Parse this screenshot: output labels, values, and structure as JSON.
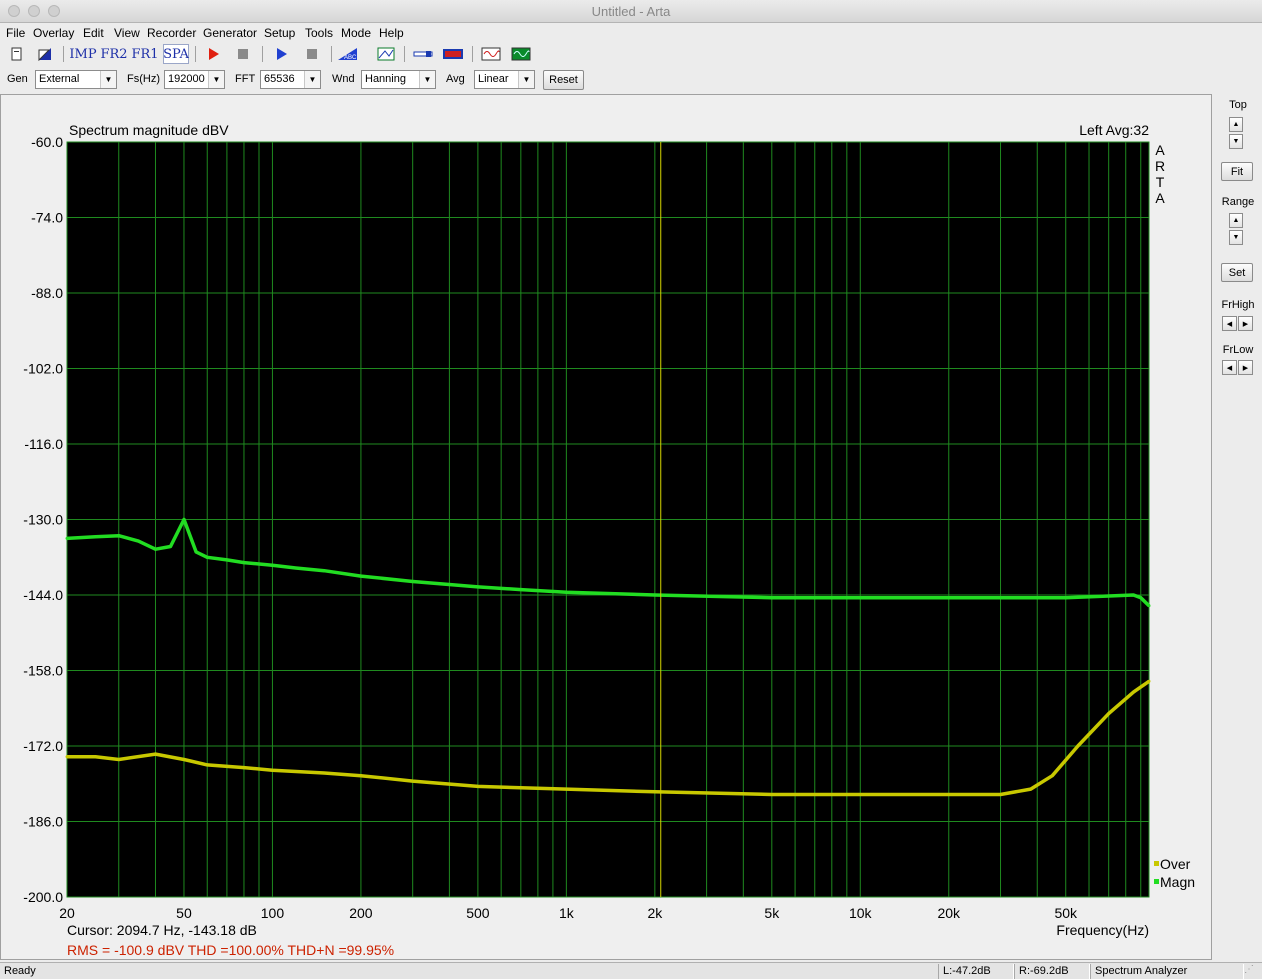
{
  "window": {
    "title": "Untitled - Arta"
  },
  "menu": [
    "File",
    "Overlay",
    "Edit",
    "View",
    "Recorder",
    "Generator",
    "Setup",
    "Tools",
    "Mode",
    "Help"
  ],
  "toolbar": {
    "imp": "IMP",
    "fr2": "FR2",
    "fr1": "FR1",
    "spa": "SPA",
    "icons": [
      "new-doc-icon",
      "open-icon",
      "record-red-icon",
      "stop-icon",
      "play-blue-icon",
      "stop2-icon",
      "abc-icon",
      "grid-icon",
      "probe-icon",
      "red-blue-icon",
      "sine-icon",
      "scope-icon"
    ]
  },
  "controls": {
    "gen_label": "Gen",
    "gen_value": "External",
    "fs_label": "Fs(Hz)",
    "fs_value": "192000",
    "fft_label": "FFT",
    "fft_value": "65536",
    "wnd_label": "Wnd",
    "wnd_value": "Hanning",
    "avg_label": "Avg",
    "avg_value": "Linear",
    "reset_label": "Reset"
  },
  "plot": {
    "title": "Spectrum magnitude dBV",
    "channel_info": "Left  Avg:32",
    "brand": [
      "A",
      "R",
      "T",
      "A"
    ],
    "xlabel": "Frequency(Hz)",
    "cursor_text": "Cursor:  2094.7 Hz, -143.18 dB",
    "stats_text": "RMS = -100.9 dBV   THD =100.00%   THD+N =99.95%",
    "legend": [
      {
        "name": "Over",
        "color": "#c8c800"
      },
      {
        "name": "Magn",
        "color": "#22dd22"
      }
    ],
    "colors": {
      "background": "#000000",
      "grid": "#1f8a1f",
      "cursor": "#d6d600",
      "stats": "#cc2200"
    }
  },
  "chart_data": {
    "type": "line",
    "title": "Spectrum magnitude dBV",
    "xlabel": "Frequency(Hz)",
    "ylabel": "",
    "xscale": "log",
    "xlim": [
      20,
      96000
    ],
    "ylim": [
      -200,
      -60
    ],
    "yticks": [
      "-60.0",
      "-74.0",
      "-88.0",
      "-102.0",
      "-116.0",
      "-130.0",
      "-144.0",
      "-158.0",
      "-172.0",
      "-186.0",
      "-200.0"
    ],
    "yticks_values": [
      -60,
      -74,
      -88,
      -102,
      -116,
      -130,
      -144,
      -158,
      -172,
      -186,
      -200
    ],
    "xticks": [
      {
        "label": "20",
        "value": 20
      },
      {
        "label": "50",
        "value": 50
      },
      {
        "label": "100",
        "value": 100
      },
      {
        "label": "200",
        "value": 200
      },
      {
        "label": "500",
        "value": 500
      },
      {
        "label": "1k",
        "value": 1000
      },
      {
        "label": "2k",
        "value": 2000
      },
      {
        "label": "5k",
        "value": 5000
      },
      {
        "label": "10k",
        "value": 10000
      },
      {
        "label": "20k",
        "value": 20000
      },
      {
        "label": "50k",
        "value": 50000
      }
    ],
    "cursor": {
      "x": 2094.7,
      "y": -143.18
    },
    "grid": true,
    "legend_position": "bottom-right",
    "series": [
      {
        "name": "Magn",
        "color": "#22dd22",
        "x": [
          20,
          25,
          30,
          35,
          40,
          45,
          50,
          55,
          60,
          70,
          80,
          100,
          120,
          150,
          200,
          300,
          500,
          700,
          1000,
          2000,
          5000,
          10000,
          20000,
          50000,
          85000,
          90000,
          96000
        ],
        "y": [
          -133.5,
          -133.2,
          -133.0,
          -134.0,
          -135.5,
          -135.0,
          -130.0,
          -136.0,
          -137.0,
          -137.5,
          -138.0,
          -138.5,
          -139.0,
          -139.5,
          -140.5,
          -141.5,
          -142.5,
          -143.0,
          -143.5,
          -144.0,
          -144.5,
          -144.5,
          -144.5,
          -144.5,
          -144.0,
          -144.5,
          -146.0
        ]
      },
      {
        "name": "Over",
        "color": "#c8c800",
        "x": [
          20,
          25,
          30,
          40,
          50,
          60,
          80,
          100,
          150,
          200,
          300,
          500,
          1000,
          2000,
          5000,
          10000,
          20000,
          30000,
          38000,
          45000,
          55000,
          70000,
          85000,
          96000
        ],
        "y": [
          -174.0,
          -174.0,
          -174.5,
          -173.5,
          -174.5,
          -175.5,
          -176.0,
          -176.5,
          -177.0,
          -177.5,
          -178.5,
          -179.5,
          -180.0,
          -180.5,
          -181.0,
          -181.0,
          -181.0,
          -181.0,
          -180.0,
          -177.5,
          -172.0,
          -166.0,
          -162.0,
          -160.0
        ]
      }
    ]
  },
  "right_panel": {
    "top_label": "Top",
    "fit_label": "Fit",
    "range_label": "Range",
    "set_label": "Set",
    "frhigh_label": "FrHigh",
    "frlow_label": "FrLow"
  },
  "status": {
    "ready": "Ready",
    "left_level": "L:-47.2dB",
    "right_level": "R:-69.2dB",
    "mode": "Spectrum Analyzer"
  }
}
